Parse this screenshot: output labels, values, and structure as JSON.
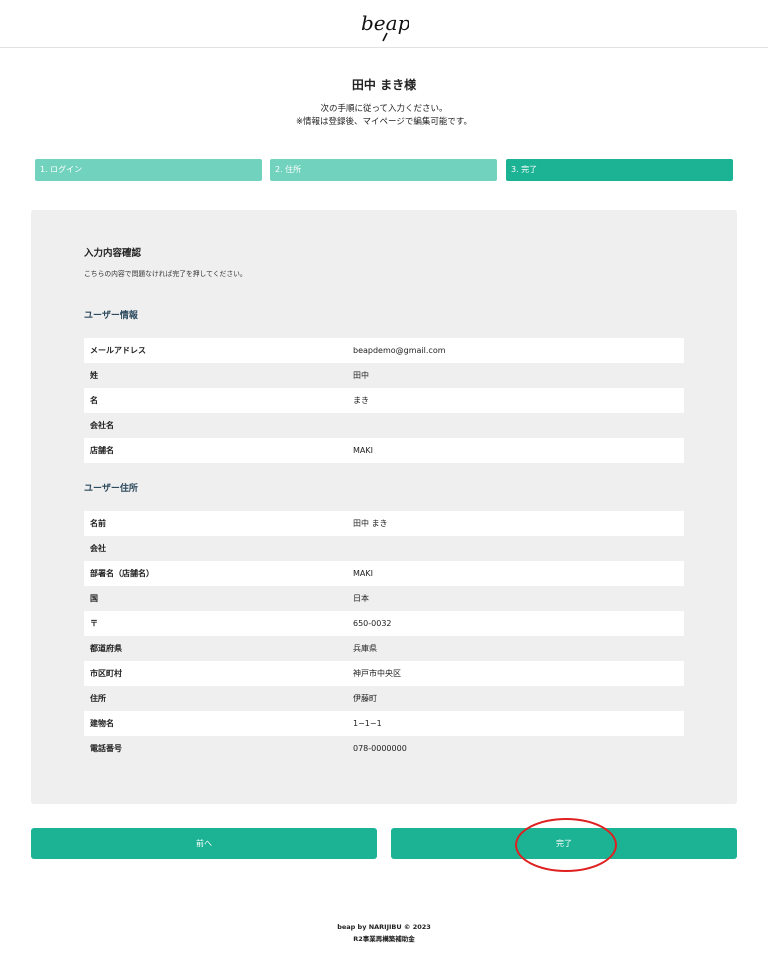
{
  "header": {
    "logo_text": "beap"
  },
  "greeting": "田中 まき様",
  "instructions": {
    "line1": "次の手順に従って入力ください。",
    "line2": "※情報は登録後、マイページで編集可能です。"
  },
  "steps": [
    {
      "label": "1. ログイン"
    },
    {
      "label": "2. 住所"
    },
    {
      "label": "3. 完了"
    }
  ],
  "confirm": {
    "title": "入力内容確認",
    "subtitle": "こちらの内容で問題なければ完了を押してください。"
  },
  "user_info": {
    "title": "ユーザー情報",
    "rows": [
      {
        "label": "メールアドレス",
        "value": "beapdemo@gmail.com"
      },
      {
        "label": "姓",
        "value": "田中"
      },
      {
        "label": "名",
        "value": "まき"
      },
      {
        "label": "会社名",
        "value": ""
      },
      {
        "label": "店舗名",
        "value": "MAKI"
      }
    ]
  },
  "user_address": {
    "title": "ユーザー住所",
    "rows": [
      {
        "label": "名前",
        "value": "田中 まき"
      },
      {
        "label": "会社",
        "value": ""
      },
      {
        "label": "部署名（店舗名）",
        "value": "MAKI"
      },
      {
        "label": "国",
        "value": "日本"
      },
      {
        "label": "〒",
        "value": "650-0032"
      },
      {
        "label": "都道府県",
        "value": "兵庫県"
      },
      {
        "label": "市区町村",
        "value": "神戸市中央区"
      },
      {
        "label": "住所",
        "value": "伊藤町"
      },
      {
        "label": "建物名",
        "value": "1−1−1"
      },
      {
        "label": "電話番号",
        "value": "078-0000000"
      }
    ]
  },
  "buttons": {
    "back": "前へ",
    "complete": "完了"
  },
  "footer": {
    "line1": "beap by NARIJIBU © 2023",
    "line2": "R2事業再構築補助金"
  },
  "colors": {
    "accent": "#1cb394",
    "accent_light": "#71d2bd",
    "panel_bg": "#efefef",
    "annotation": "#e02020"
  }
}
